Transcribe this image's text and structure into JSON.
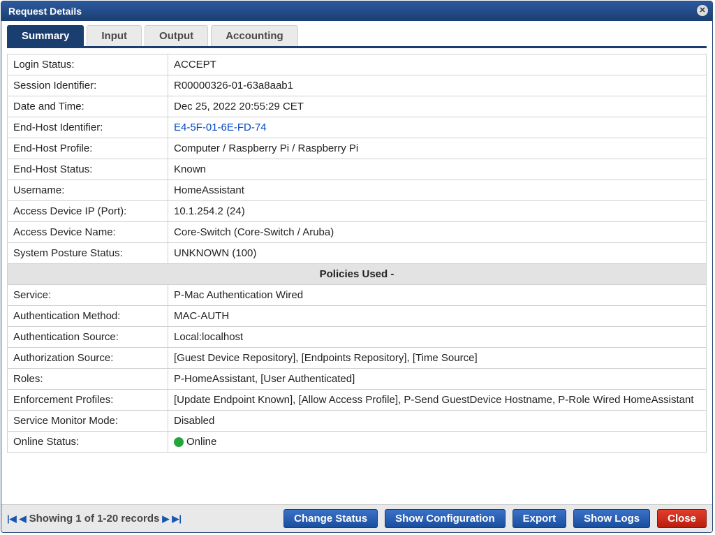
{
  "window": {
    "title": "Request Details"
  },
  "tabs": [
    {
      "label": "Summary",
      "active": true
    },
    {
      "label": "Input",
      "active": false
    },
    {
      "label": "Output",
      "active": false
    },
    {
      "label": "Accounting",
      "active": false
    }
  ],
  "top_rows": [
    {
      "label": "Login Status:",
      "value": "ACCEPT"
    },
    {
      "label": "Session Identifier:",
      "value": "R00000326-01-63a8aab1"
    },
    {
      "label": "Date and Time:",
      "value": "Dec 25, 2022 20:55:29 CET"
    },
    {
      "label": "End-Host Identifier:",
      "value": "E4-5F-01-6E-FD-74",
      "is_link": true
    },
    {
      "label": "End-Host Profile:",
      "value": "Computer / Raspberry Pi / Raspberry Pi"
    },
    {
      "label": "End-Host Status:",
      "value": "Known"
    },
    {
      "label": "Username:",
      "value": "HomeAssistant"
    },
    {
      "label": "Access Device IP (Port):",
      "value": "10.1.254.2 (24)"
    },
    {
      "label": "Access Device Name:",
      "value": "Core-Switch (Core-Switch / Aruba)"
    },
    {
      "label": "System Posture Status:",
      "value": "UNKNOWN (100)"
    }
  ],
  "section_header": "Policies Used -",
  "policy_rows": [
    {
      "label": "Service:",
      "value": "P-Mac Authentication Wired"
    },
    {
      "label": "Authentication Method:",
      "value": "MAC-AUTH"
    },
    {
      "label": "Authentication Source:",
      "value": "Local:localhost"
    },
    {
      "label": "Authorization Source:",
      "value": "[Guest Device Repository], [Endpoints Repository], [Time Source]"
    },
    {
      "label": "Roles:",
      "value": "P-HomeAssistant, [User Authenticated]"
    },
    {
      "label": "Enforcement Profiles:",
      "value": "[Update Endpoint Known], [Allow Access Profile], P-Send GuestDevice Hostname, P-Role Wired HomeAssistant"
    },
    {
      "label": "Service Monitor Mode:",
      "value": "Disabled"
    },
    {
      "label": "Online Status:",
      "value": "Online",
      "online": true
    }
  ],
  "pager": {
    "text": "Showing 1 of 1-20 records"
  },
  "buttons": {
    "change_status": "Change Status",
    "show_configuration": "Show Configuration",
    "export": "Export",
    "show_logs": "Show Logs",
    "close": "Close"
  }
}
